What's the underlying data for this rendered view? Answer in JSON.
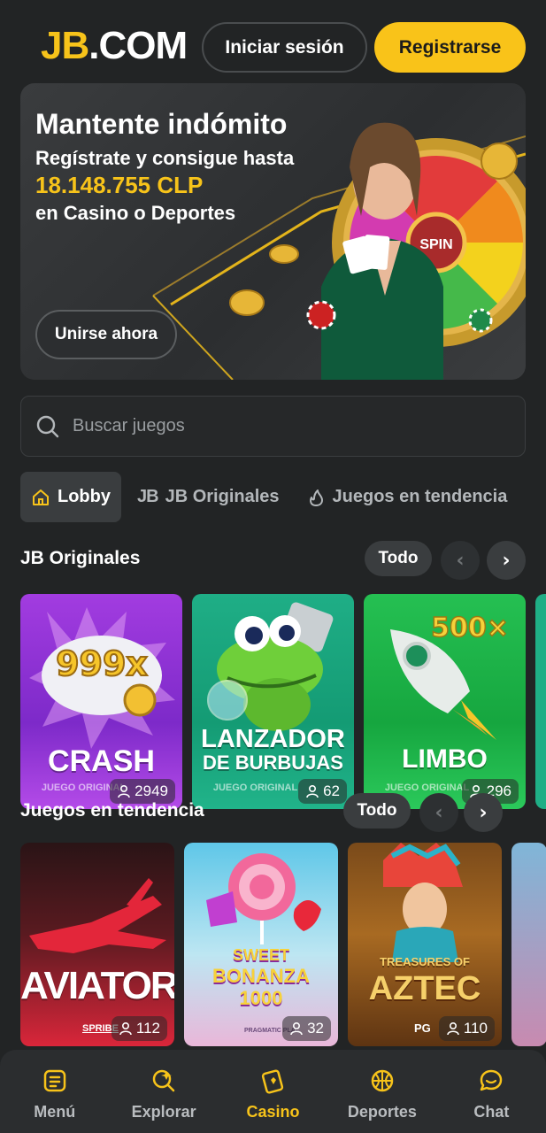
{
  "header": {
    "logo_jb": "JB",
    "logo_com": ".COM",
    "login_label": "Iniciar sesión",
    "register_label": "Registrarse"
  },
  "banner": {
    "title": "Mantente indómito",
    "line1": "Regístrate y consigue hasta",
    "amount": "18.148.755 CLP",
    "line2": "en Casino o Deportes",
    "join_label": "Unirse ahora",
    "wheel_label": "SPIN"
  },
  "search": {
    "placeholder": "Buscar juegos"
  },
  "tabs": [
    {
      "label": "Lobby",
      "icon": "home-icon",
      "active": true
    },
    {
      "label": "JB Originales",
      "icon": "jb-icon",
      "active": false
    },
    {
      "label": "Juegos en tendencia",
      "icon": "flame-icon",
      "active": false
    }
  ],
  "originals": {
    "title": "JB Originales",
    "all_label": "Todo",
    "prev": "‹",
    "next": "›",
    "games": [
      {
        "name": "CRASH",
        "tag": "JUEGO ORIGINAL",
        "players": "2949",
        "art_text": "999x"
      },
      {
        "name_line1": "LANZADOR",
        "name_line2": "DE BURBUJAS",
        "tag": "JUEGO ORIGINAL",
        "players": "62"
      },
      {
        "name": "LIMBO",
        "tag": "JUEGO ORIGINAL",
        "players": "296",
        "art_text": "500×"
      }
    ]
  },
  "trending": {
    "title": "Juegos en tendencia",
    "all_label": "Todo",
    "prev": "‹",
    "next": "›",
    "games": [
      {
        "name": "AVIATOR",
        "provider": "SPRIBE",
        "players": "112"
      },
      {
        "name_line1": "SWEET",
        "name_line2": "BONANZA",
        "name_line3": "1000",
        "provider": "PRAGMATIC PLAY",
        "players": "32"
      },
      {
        "name_line1": "TREASURES OF",
        "name_line2": "AZTEC",
        "provider": "PG",
        "players": "110"
      }
    ]
  },
  "bottom_nav": [
    {
      "label": "Menú",
      "icon": "menu-icon",
      "active": false
    },
    {
      "label": "Explorar",
      "icon": "explore-icon",
      "active": false
    },
    {
      "label": "Casino",
      "icon": "casino-icon",
      "active": true
    },
    {
      "label": "Deportes",
      "icon": "basketball-icon",
      "active": false
    },
    {
      "label": "Chat",
      "icon": "chat-icon",
      "active": false
    }
  ],
  "colors": {
    "background": "#222425",
    "accent": "#f7c31a",
    "card_dark": "#3a3d3f"
  }
}
